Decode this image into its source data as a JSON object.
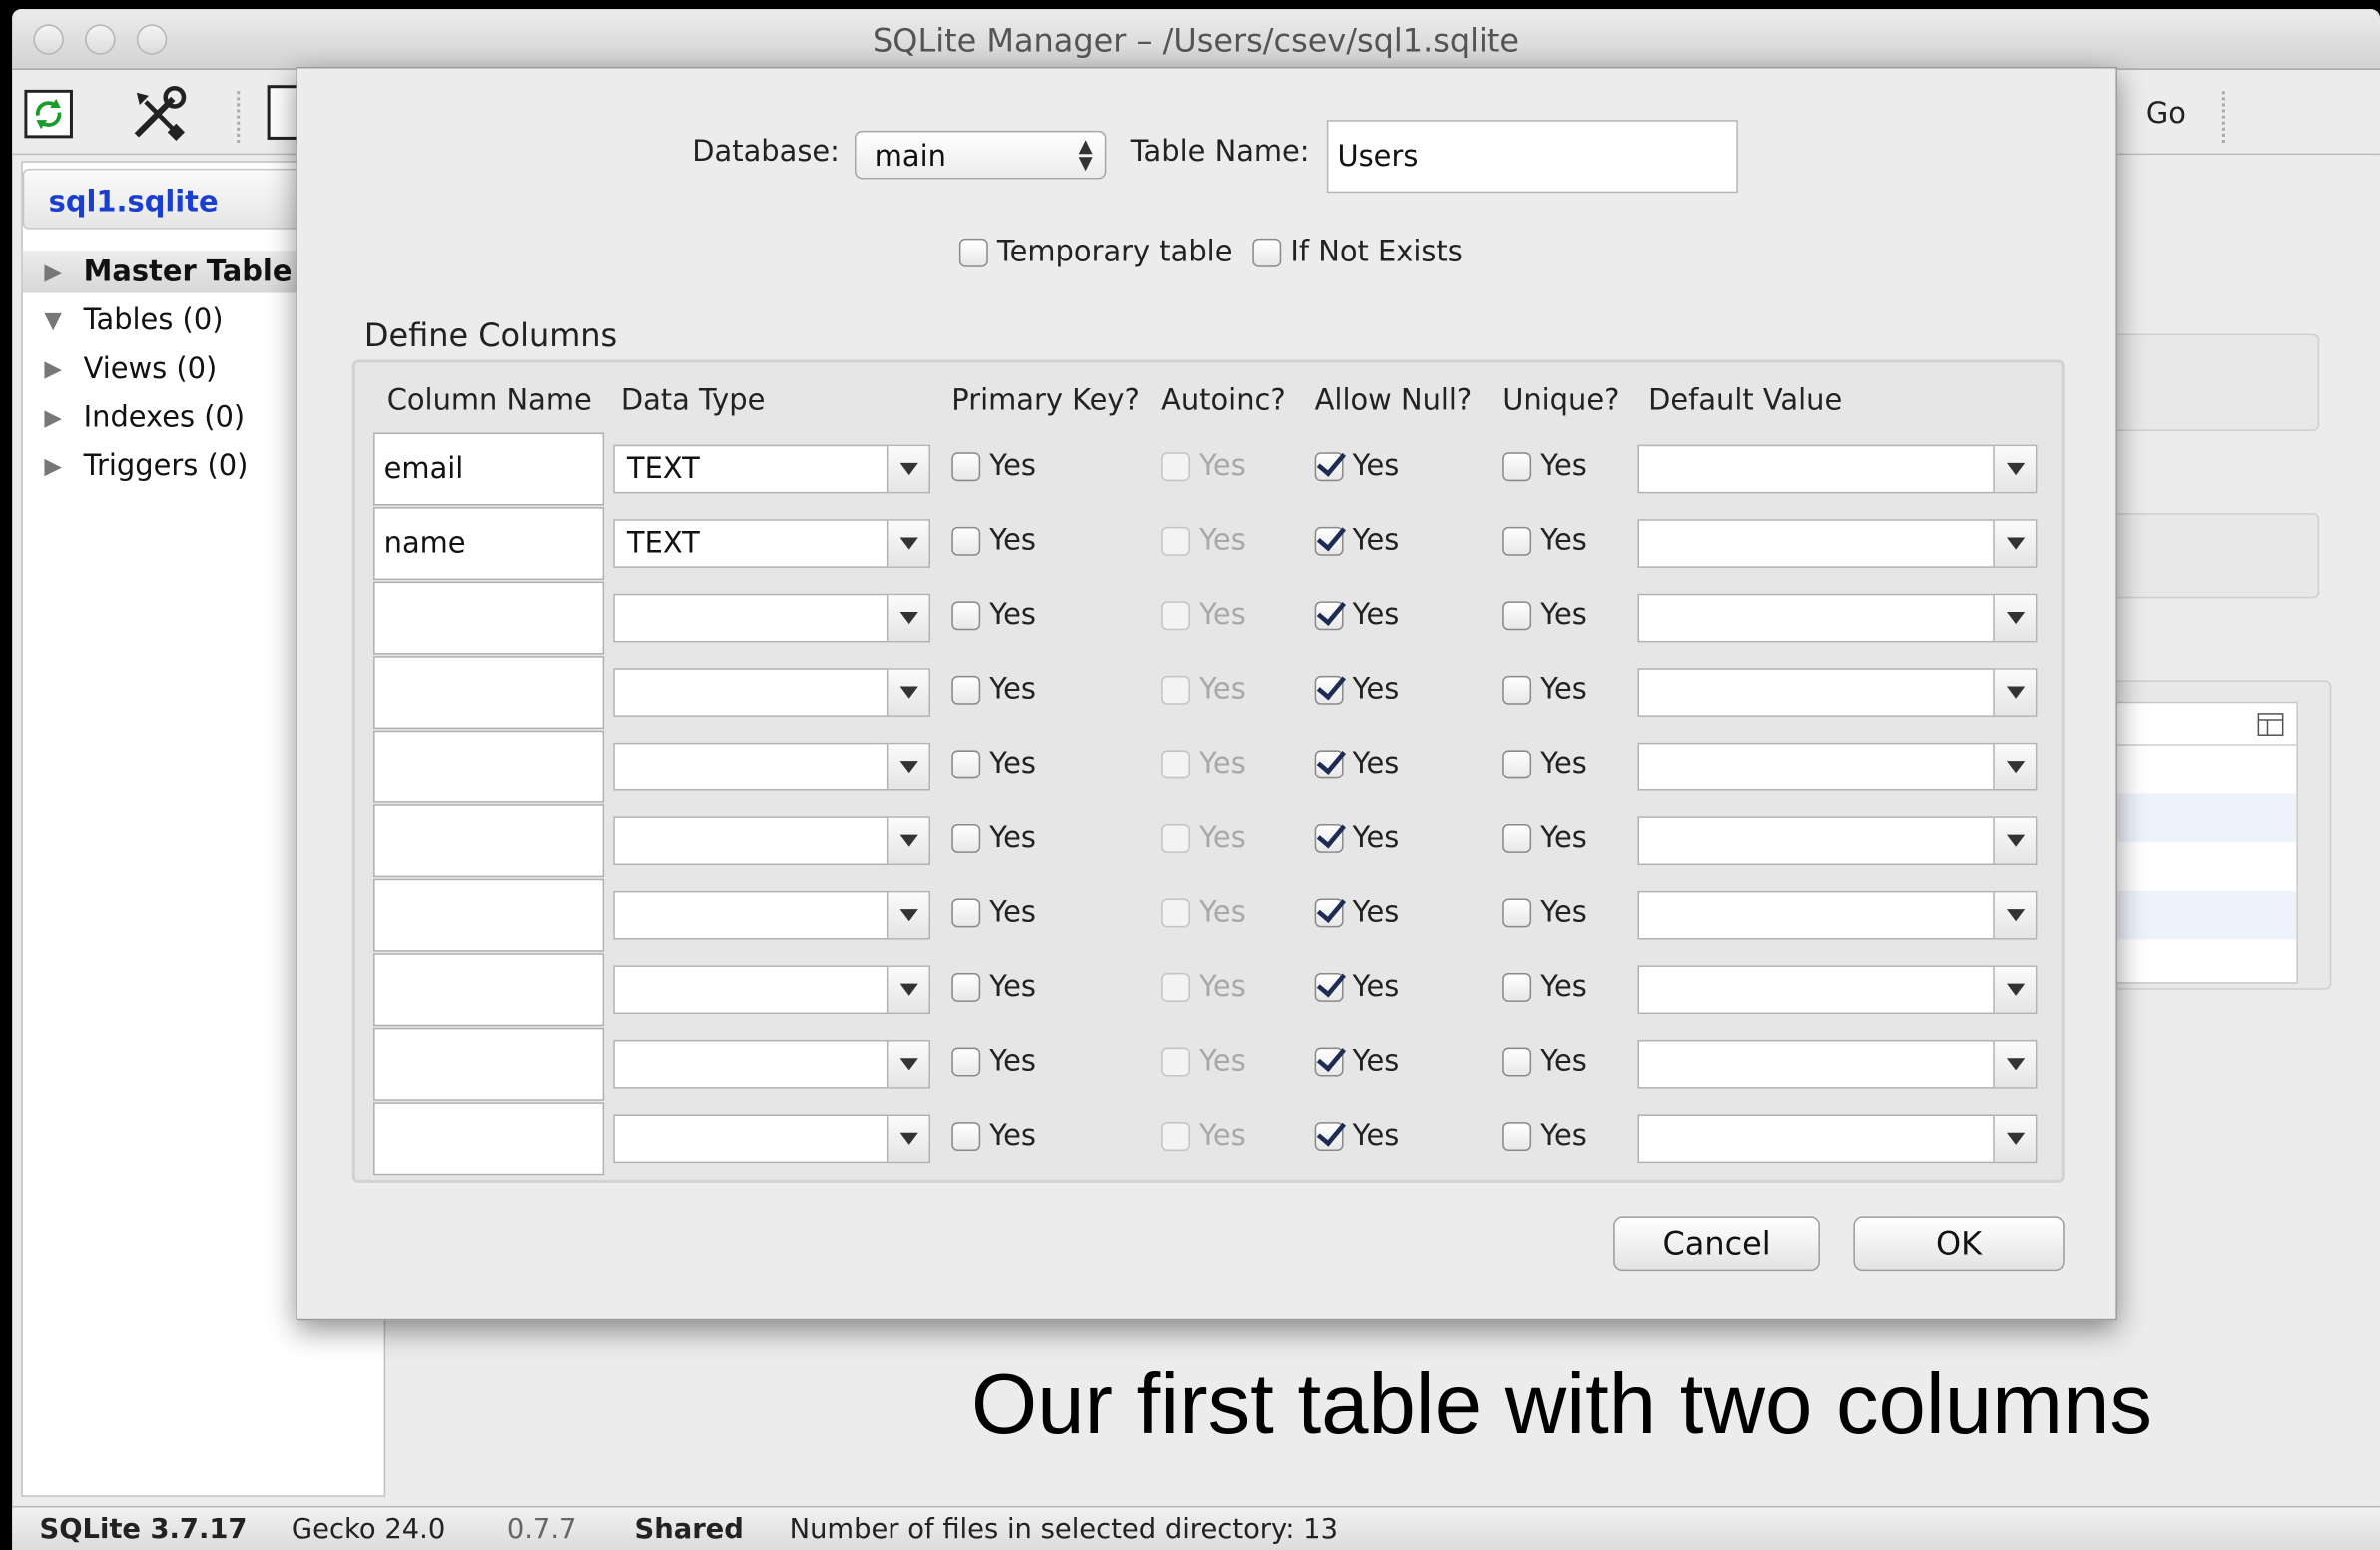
{
  "window": {
    "title": "SQLite Manager – /Users/csev/sql1.sqlite"
  },
  "toolbar": {
    "go_label": "Go"
  },
  "sidebar": {
    "db_tab": "sql1.sqlite",
    "items": [
      {
        "label": "Master Table (",
        "expanded": false
      },
      {
        "label": "Tables (0)",
        "expanded": true
      },
      {
        "label": "Views (0)",
        "expanded": false
      },
      {
        "label": "Indexes (0)",
        "expanded": false
      },
      {
        "label": "Triggers (0)",
        "expanded": false
      }
    ]
  },
  "dialog": {
    "database_label": "Database:",
    "database_value": "main",
    "table_name_label": "Table Name:",
    "table_name_value": "Users",
    "temporary_label": "Temporary table",
    "if_not_exists_label": "If Not Exists",
    "define_columns_label": "Define Columns",
    "headers": [
      "Column Name",
      "Data Type",
      "Primary Key?",
      "Autoinc?",
      "Allow Null?",
      "Unique?",
      "Default Value"
    ],
    "yes_label": "Yes",
    "rows": [
      {
        "name": "email",
        "type": "TEXT",
        "pk": false,
        "autoinc": false,
        "allow_null": true,
        "unique": false,
        "default": ""
      },
      {
        "name": "name",
        "type": "TEXT",
        "pk": false,
        "autoinc": false,
        "allow_null": true,
        "unique": false,
        "default": ""
      },
      {
        "name": "",
        "type": "",
        "pk": false,
        "autoinc": false,
        "allow_null": true,
        "unique": false,
        "default": ""
      },
      {
        "name": "",
        "type": "",
        "pk": false,
        "autoinc": false,
        "allow_null": true,
        "unique": false,
        "default": ""
      },
      {
        "name": "",
        "type": "",
        "pk": false,
        "autoinc": false,
        "allow_null": true,
        "unique": false,
        "default": ""
      },
      {
        "name": "",
        "type": "",
        "pk": false,
        "autoinc": false,
        "allow_null": true,
        "unique": false,
        "default": ""
      },
      {
        "name": "",
        "type": "",
        "pk": false,
        "autoinc": false,
        "allow_null": true,
        "unique": false,
        "default": ""
      },
      {
        "name": "",
        "type": "",
        "pk": false,
        "autoinc": false,
        "allow_null": true,
        "unique": false,
        "default": ""
      },
      {
        "name": "",
        "type": "",
        "pk": false,
        "autoinc": false,
        "allow_null": true,
        "unique": false,
        "default": ""
      },
      {
        "name": "",
        "type": "",
        "pk": false,
        "autoinc": false,
        "allow_null": true,
        "unique": false,
        "default": ""
      }
    ],
    "cancel_label": "Cancel",
    "ok_label": "OK"
  },
  "status": {
    "sqlite": "SQLite 3.7.17",
    "gecko": "Gecko 24.0",
    "ext_version": "0.7.7",
    "mode": "Shared",
    "files": "Number of files in selected directory: 13"
  },
  "caption": "Our first table with two columns"
}
